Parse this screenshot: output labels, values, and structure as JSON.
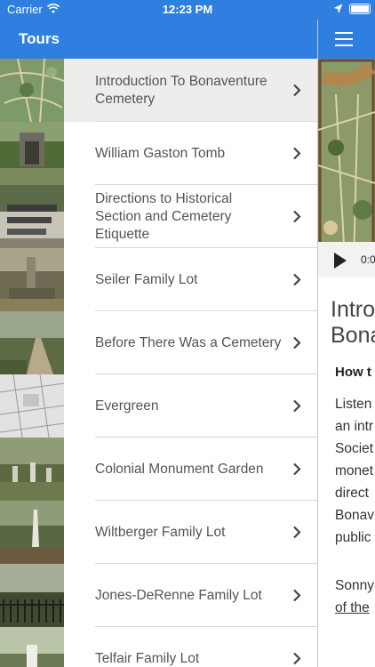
{
  "status": {
    "carrier": "Carrier",
    "time": "12:23 PM"
  },
  "nav": {
    "title": "Tours"
  },
  "tours": [
    {
      "label": "Introduction To Bonaventure Cemetery",
      "selected": true
    },
    {
      "label": "William Gaston Tomb"
    },
    {
      "label": "Directions to Historical Section and Cemetery Etiquette"
    },
    {
      "label": "Seiler Family Lot"
    },
    {
      "label": "Before There Was a Cemetery"
    },
    {
      "label": "Evergreen"
    },
    {
      "label": "Colonial Monument Garden"
    },
    {
      "label": "Wiltberger Family Lot"
    },
    {
      "label": "Jones-DeRenne Family Lot"
    },
    {
      "label": "Telfair Family Lot"
    }
  ],
  "detail": {
    "player_time": "0:0",
    "title_line1": "Intro",
    "title_line2": "Bona",
    "subheading": "How t",
    "body_lines": [
      "Listen",
      "an intr",
      "Societ",
      "monet",
      "direct",
      "Bonav",
      "public"
    ],
    "body2_line1": "Sonny",
    "body2_line2": "of the"
  },
  "colors": {
    "accent": "#2f7fe0",
    "selected_row": "#eeedec"
  }
}
